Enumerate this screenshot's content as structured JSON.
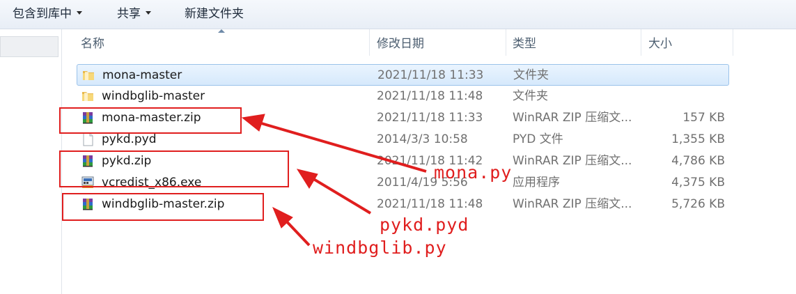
{
  "toolbar": {
    "include_library": "包含到库中",
    "share": "共享",
    "new_folder": "新建文件夹"
  },
  "columns": {
    "name": "名称",
    "date": "修改日期",
    "type": "类型",
    "size": "大小"
  },
  "files": [
    {
      "name": "mona-master",
      "date": "2021/11/18 11:33",
      "type": "文件夹",
      "size": "",
      "icon": "folder-icon",
      "selected": true
    },
    {
      "name": "windbglib-master",
      "date": "2021/11/18 11:48",
      "type": "文件夹",
      "size": "",
      "icon": "folder-icon",
      "selected": false
    },
    {
      "name": "mona-master.zip",
      "date": "2021/11/18 11:33",
      "type": "WinRAR ZIP 压缩文...",
      "size": "157 KB",
      "icon": "winrar-archive-icon",
      "selected": false
    },
    {
      "name": "pykd.pyd",
      "date": "2014/3/3 10:58",
      "type": "PYD 文件",
      "size": "1,355 KB",
      "icon": "file-icon",
      "selected": false
    },
    {
      "name": "pykd.zip",
      "date": "2021/11/18 11:42",
      "type": "WinRAR ZIP 压缩文...",
      "size": "4,786 KB",
      "icon": "winrar-archive-icon",
      "selected": false
    },
    {
      "name": "vcredist_x86.exe",
      "date": "2011/4/19 5:56",
      "type": "应用程序",
      "size": "4,375 KB",
      "icon": "installer-icon",
      "selected": false
    },
    {
      "name": "windbglib-master.zip",
      "date": "2021/11/18 11:48",
      "type": "WinRAR ZIP 压缩文...",
      "size": "5,726 KB",
      "icon": "winrar-archive-icon",
      "selected": false
    }
  ],
  "annotations": {
    "mona": "mona.py",
    "pykd": "pykd.pyd",
    "windbglib": "windbglib.py",
    "color": "#e01e1e"
  }
}
